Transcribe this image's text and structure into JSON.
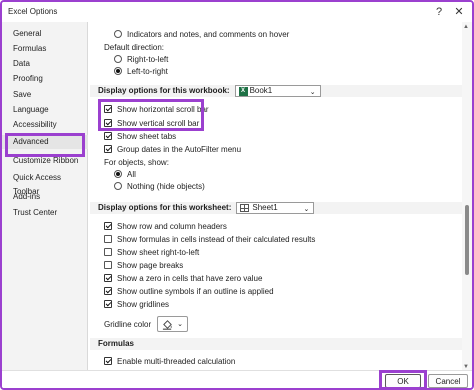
{
  "window": {
    "title": "Excel Options",
    "help": "?",
    "close": "✕"
  },
  "sidebar": {
    "items": [
      {
        "label": "General"
      },
      {
        "label": "Formulas"
      },
      {
        "label": "Data"
      },
      {
        "label": "Proofing"
      },
      {
        "label": "Save"
      },
      {
        "label": "Language"
      },
      {
        "label": "Accessibility"
      },
      {
        "label": "Advanced",
        "active": true
      },
      {
        "label": "Customize Ribbon"
      },
      {
        "label": "Quick Access Toolbar"
      },
      {
        "label": "Add-ins"
      },
      {
        "label": "Trust Center"
      }
    ]
  },
  "options": {
    "indicators_notes": "Indicators and notes, and comments on hover",
    "default_direction_label": "Default direction:",
    "right_to_left": "Right-to-left",
    "left_to_right": "Left-to-right",
    "workbook_section": "Display options for this workbook:",
    "workbook_select": "Book1",
    "horizontal_scroll": "Show horizontal scroll bar",
    "vertical_scroll": "Show vertical scroll bar",
    "sheet_tabs": "Show sheet tabs",
    "group_dates": "Group dates in the AutoFilter menu",
    "for_objects_label": "For objects, show:",
    "objects_all": "All",
    "objects_nothing": "Nothing (hide objects)",
    "worksheet_section": "Display options for this worksheet:",
    "worksheet_select": "Sheet1",
    "row_col_headers": "Show row and column headers",
    "show_formulas": "Show formulas in cells instead of their calculated results",
    "sheet_rtl": "Show sheet right-to-left",
    "page_breaks": "Show page breaks",
    "zero_values": "Show a zero in cells that have zero value",
    "outline_symbols": "Show outline symbols if an outline is applied",
    "gridlines": "Show gridlines",
    "gridline_color_label": "Gridline color",
    "formulas_section": "Formulas",
    "multithreaded": "Enable multi-threaded calculation"
  },
  "footer": {
    "ok": "OK",
    "cancel": "Cancel"
  },
  "colors": {
    "highlight": "#9b40cf",
    "excel_green": "#1e7145"
  }
}
